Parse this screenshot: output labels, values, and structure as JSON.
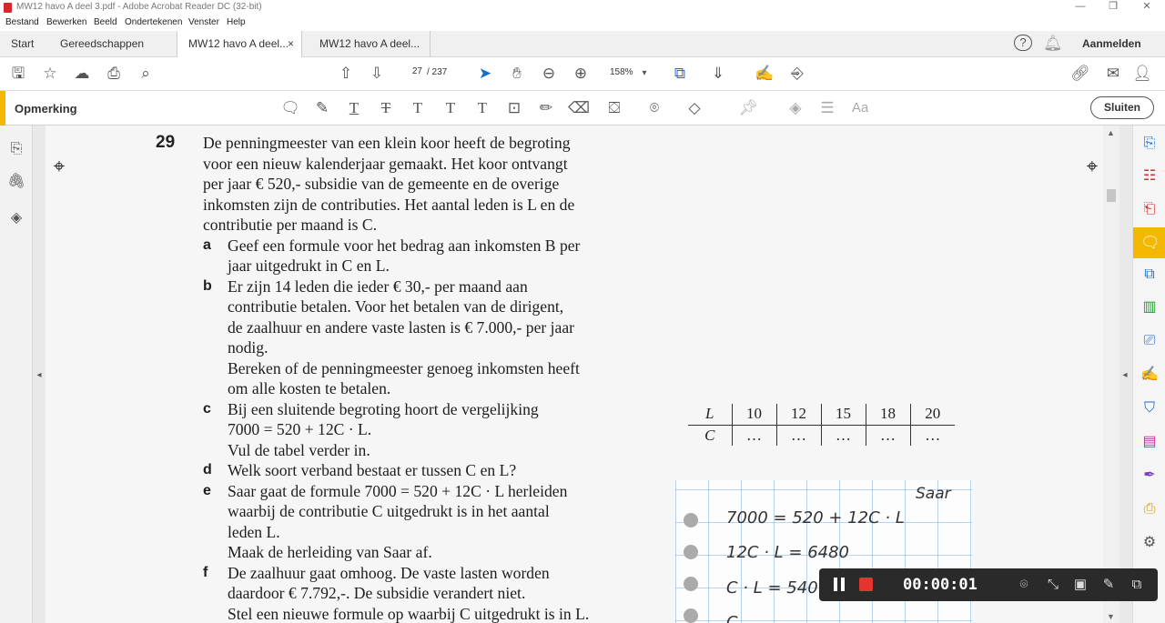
{
  "window": {
    "title": "MW12 havo A deel 3.pdf - Adobe Acrobat Reader DC (32-bit)",
    "minimize": "—",
    "maximize": "❐",
    "close": "✕"
  },
  "menu": [
    "Bestand",
    "Bewerken",
    "Beeld",
    "Ondertekenen",
    "Venster",
    "Help"
  ],
  "tabs": {
    "start": "Start",
    "tools": "Gereedschappen",
    "doc1": "MW12 havo A deel...",
    "doc2": "MW12 havo A deel...",
    "close": "×",
    "signin": "Aanmelden"
  },
  "toolbar": {
    "page_current": "27",
    "page_total": "/ 237",
    "zoom": "158%"
  },
  "comment_toolbar": {
    "label": "Opmerking",
    "close": "Sluiten"
  },
  "problem": {
    "number": "29",
    "intro": [
      "De penningmeester van een klein koor heeft de begroting",
      "voor een nieuw kalenderjaar gemaakt. Het koor ontvangt",
      "per jaar € 520,- subsidie van de gemeente en de overige",
      "inkomsten zijn de contributies. Het aantal leden is L en de",
      "contributie per maand is C."
    ],
    "items": [
      {
        "letter": "a",
        "lines": [
          "Geef een formule voor het bedrag aan inkomsten B per",
          "jaar uitgedrukt in C en L."
        ]
      },
      {
        "letter": "b",
        "lines": [
          "Er zijn 14 leden die ieder € 30,- per maand aan",
          "contributie betalen. Voor het betalen van de dirigent,",
          "de zaalhuur en andere vaste lasten is € 7.000,- per jaar",
          "nodig.",
          "Bereken of de penningmeester genoeg inkomsten heeft",
          "om alle kosten te betalen."
        ]
      },
      {
        "letter": "c",
        "lines": [
          "Bij een sluitende begroting hoort de vergelijking",
          "7000 = 520 + 12C · L.",
          "Vul de tabel verder in."
        ]
      },
      {
        "letter": "d",
        "lines": [
          "Welk soort verband bestaat er tussen C en L?"
        ]
      },
      {
        "letter": "e",
        "lines": [
          "Saar gaat de formule 7000 = 520 + 12C · L herleiden",
          "waarbij de contributie C uitgedrukt is in het aantal",
          "leden L.",
          "Maak de herleiding van Saar af."
        ]
      },
      {
        "letter": "f",
        "lines": [
          "De zaalhuur gaat omhoog. De vaste lasten worden",
          "daardoor € 7.792,-. De subsidie verandert niet.",
          "Stel een nieuwe formule op waarbij C uitgedrukt is in L."
        ]
      }
    ]
  },
  "table": {
    "row_labels": [
      "L",
      "C"
    ],
    "L_values": [
      "10",
      "12",
      "15",
      "18",
      "20"
    ],
    "C_values": [
      "…",
      "…",
      "…",
      "…",
      "…"
    ]
  },
  "notebook": {
    "name": "Saar",
    "lines": [
      "7000 = 520 + 12C · L",
      "12C · L = 6480",
      "C · L = 540",
      "C"
    ]
  },
  "recorder": {
    "time": "00:00:01"
  }
}
